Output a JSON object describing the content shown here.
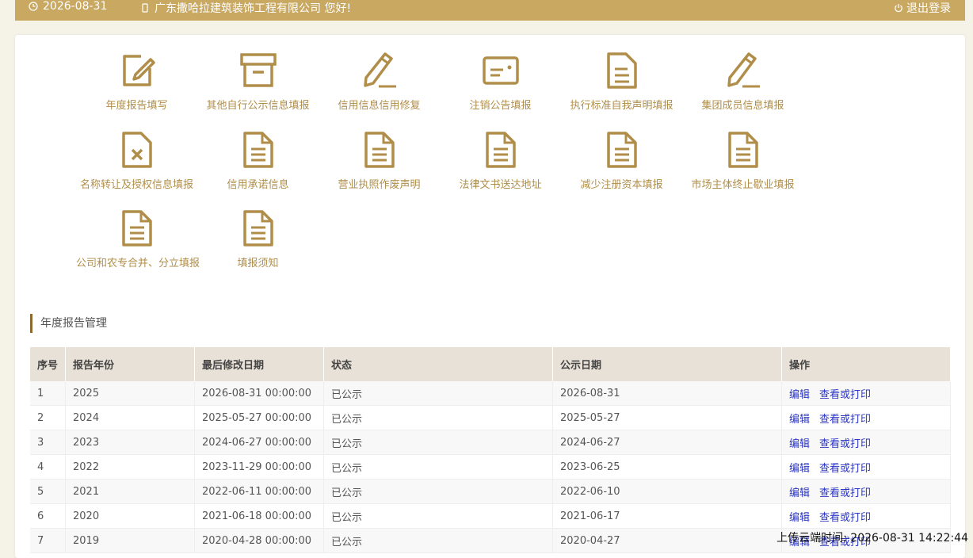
{
  "header": {
    "date": "2026-08-31",
    "greeting": "广东撒哈拉建筑装饰工程有限公司 您好!",
    "logout_label": "退出登录"
  },
  "tiles": [
    {
      "label": "年度报告填写",
      "icon": "edit-icon"
    },
    {
      "label": "其他自行公示信息填报",
      "icon": "archive-box-icon"
    },
    {
      "label": "信用信息信用修复",
      "icon": "pencil-icon"
    },
    {
      "label": "注销公告填报",
      "icon": "id-card-icon"
    },
    {
      "label": "执行标准自我声明填报",
      "icon": "document-icon"
    },
    {
      "label": "集团成员信息填报",
      "icon": "pencil-icon"
    },
    {
      "label": "名称转让及授权信息填报",
      "icon": "document-x-icon"
    },
    {
      "label": "信用承诺信息",
      "icon": "document-icon"
    },
    {
      "label": "营业执照作废声明",
      "icon": "document-icon"
    },
    {
      "label": "法律文书送达地址",
      "icon": "document-icon"
    },
    {
      "label": "减少注册资本填报",
      "icon": "document-icon"
    },
    {
      "label": "市场主体终止歇业填报",
      "icon": "document-icon"
    },
    {
      "label": "公司和农专合并、分立填报",
      "icon": "document-icon"
    },
    {
      "label": "填报须知",
      "icon": "document-icon"
    }
  ],
  "section": {
    "title": "年度报告管理"
  },
  "table": {
    "headers": [
      "序号",
      "报告年份",
      "最后修改日期",
      "状态",
      "公示日期",
      "操作"
    ],
    "rows": [
      {
        "no": "1",
        "year": "2025",
        "modified": "2026-08-31 00:00:00",
        "status": "已公示",
        "pub": "2026-08-31"
      },
      {
        "no": "2",
        "year": "2024",
        "modified": "2025-05-27 00:00:00",
        "status": "已公示",
        "pub": "2025-05-27"
      },
      {
        "no": "3",
        "year": "2023",
        "modified": "2024-06-27 00:00:00",
        "status": "已公示",
        "pub": "2024-06-27"
      },
      {
        "no": "4",
        "year": "2022",
        "modified": "2023-11-29 00:00:00",
        "status": "已公示",
        "pub": "2023-06-25"
      },
      {
        "no": "5",
        "year": "2021",
        "modified": "2022-06-11 00:00:00",
        "status": "已公示",
        "pub": "2022-06-10"
      },
      {
        "no": "6",
        "year": "2020",
        "modified": "2021-06-18 00:00:00",
        "status": "已公示",
        "pub": "2021-06-17"
      },
      {
        "no": "7",
        "year": "2019",
        "modified": "2020-04-28 00:00:00",
        "status": "已公示",
        "pub": "2020-04-27"
      }
    ],
    "edit_label": "编辑",
    "view_label": "查看或打印"
  },
  "footer": {
    "timestamp": "上传云端时间: 2026-08-31 14:22:44"
  },
  "colors": {
    "accent": "#c9a862",
    "icon": "#b08e4a",
    "link": "#2b36c6"
  }
}
